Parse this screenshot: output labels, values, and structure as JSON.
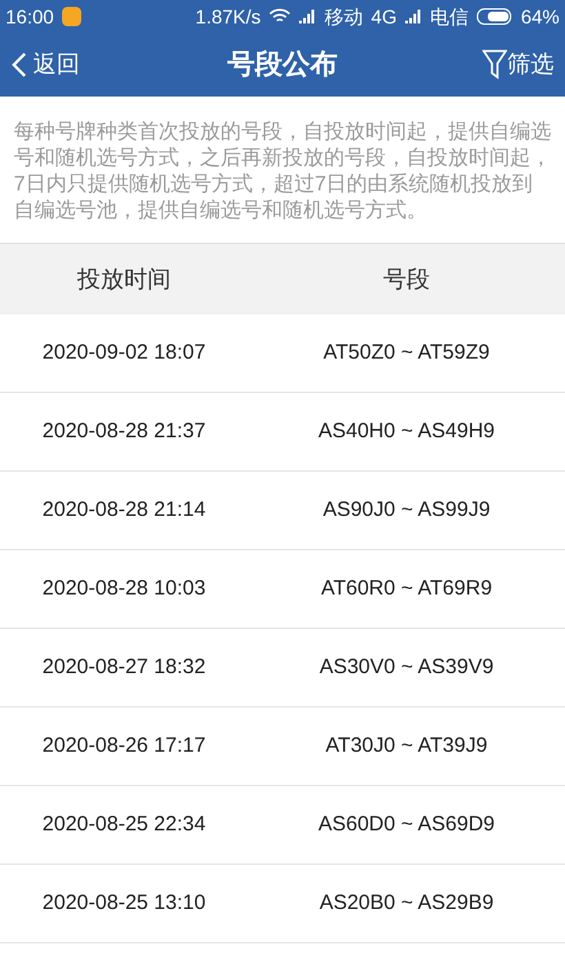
{
  "status_bar": {
    "time": "16:00",
    "speed": "1.87K/s",
    "carrier_1": "移动",
    "network_1": "4G",
    "carrier_2": "电信",
    "battery": "64%"
  },
  "nav": {
    "back": "返回",
    "title": "号段公布",
    "filter": "筛选"
  },
  "notice": "每种号牌种类首次投放的号段，自投放时间起，提供自编选号和随机选号方式，之后再新投放的号段，自投放时间起，7日内只提供随机选号方式，超过7日的由系统随机投放到自编选号池，提供自编选号和随机选号方式。",
  "table": {
    "columns": [
      "投放时间",
      "号段"
    ],
    "rows": [
      [
        "2020-09-02 18:07",
        "AT50Z0 ~ AT59Z9"
      ],
      [
        "2020-08-28 21:37",
        "AS40H0 ~ AS49H9"
      ],
      [
        "2020-08-28 21:14",
        "AS90J0 ~ AS99J9"
      ],
      [
        "2020-08-28 10:03",
        "AT60R0 ~ AT69R9"
      ],
      [
        "2020-08-27 18:32",
        "AS30V0 ~ AS39V9"
      ],
      [
        "2020-08-26 17:17",
        "AT30J0 ~ AT39J9"
      ],
      [
        "2020-08-25 22:34",
        "AS60D0 ~ AS69D9"
      ],
      [
        "2020-08-25 13:10",
        "AS20B0 ~ AS29B9"
      ]
    ]
  }
}
